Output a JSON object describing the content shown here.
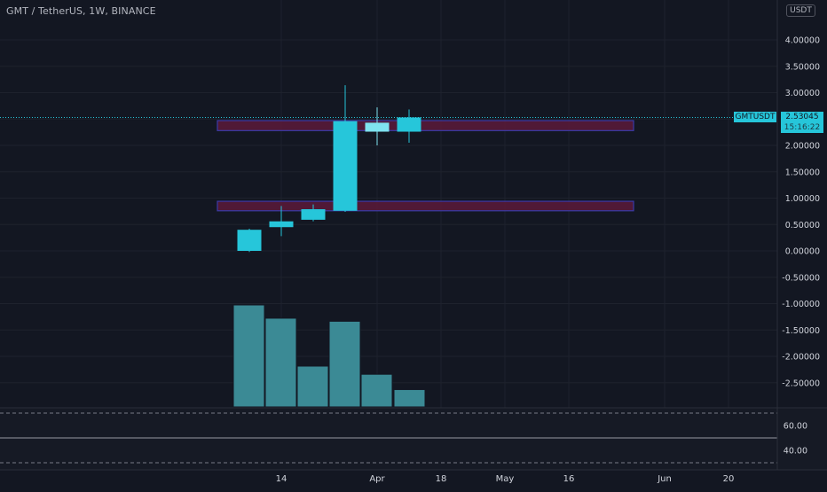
{
  "header": {
    "symbol_title": "GMT / TetherUS, 1W, BINANCE",
    "currency_badge": "USDT"
  },
  "price_label": {
    "ticker": "GMTUSDT",
    "price": "2.53045",
    "countdown": "15:16:22"
  },
  "colors": {
    "background": "#131722",
    "candle": "#26c6da",
    "candle_light": "#7fe3f0",
    "volume": "#3b8a95",
    "zone_fill": "#5c1a3a",
    "zone_border": "#3a3aa8",
    "grid": "#1e222d",
    "axis_text": "#d1d4dc"
  },
  "chart_data": [
    {
      "type": "candlestick",
      "title": "GMT / TetherUS, 1W, BINANCE",
      "x_ticks": [
        "14",
        "Apr",
        "18",
        "May",
        "16",
        "Jun",
        "20"
      ],
      "y_ticks": [
        "4.00000",
        "3.50000",
        "3.00000",
        "2.50000",
        "2.00000",
        "1.50000",
        "1.00000",
        "0.50000",
        "0.00000",
        "-0.50000",
        "-1.00000",
        "-1.50000",
        "-2.00000",
        "-2.50000"
      ],
      "ylim": [
        -2.95,
        4.5
      ],
      "current_price": 2.53045,
      "candles": [
        {
          "open": 0.0,
          "high": 0.42,
          "low": -0.02,
          "close": 0.4
        },
        {
          "open": 0.45,
          "high": 0.85,
          "low": 0.28,
          "close": 0.56
        },
        {
          "open": 0.59,
          "high": 0.88,
          "low": 0.56,
          "close": 0.79
        },
        {
          "open": 0.76,
          "high": 3.14,
          "low": 0.74,
          "close": 2.46
        },
        {
          "open": 2.26,
          "high": 2.72,
          "low": 2.0,
          "close": 2.43
        },
        {
          "open": 2.26,
          "high": 2.68,
          "low": 2.05,
          "close": 2.53
        }
      ],
      "volume_bars": [
        1.0,
        0.87,
        0.4,
        0.84,
        0.32,
        0.17
      ],
      "zones": [
        {
          "top": 2.47,
          "bottom": 2.28
        },
        {
          "top": 0.94,
          "bottom": 0.76
        }
      ]
    },
    {
      "type": "line",
      "title": "",
      "y_ticks": [
        "60.00",
        "40.00"
      ],
      "ylim": [
        34,
        68
      ],
      "bands": [
        70,
        30
      ],
      "series": [
        {
          "values": [
            50,
            50
          ]
        }
      ]
    }
  ]
}
